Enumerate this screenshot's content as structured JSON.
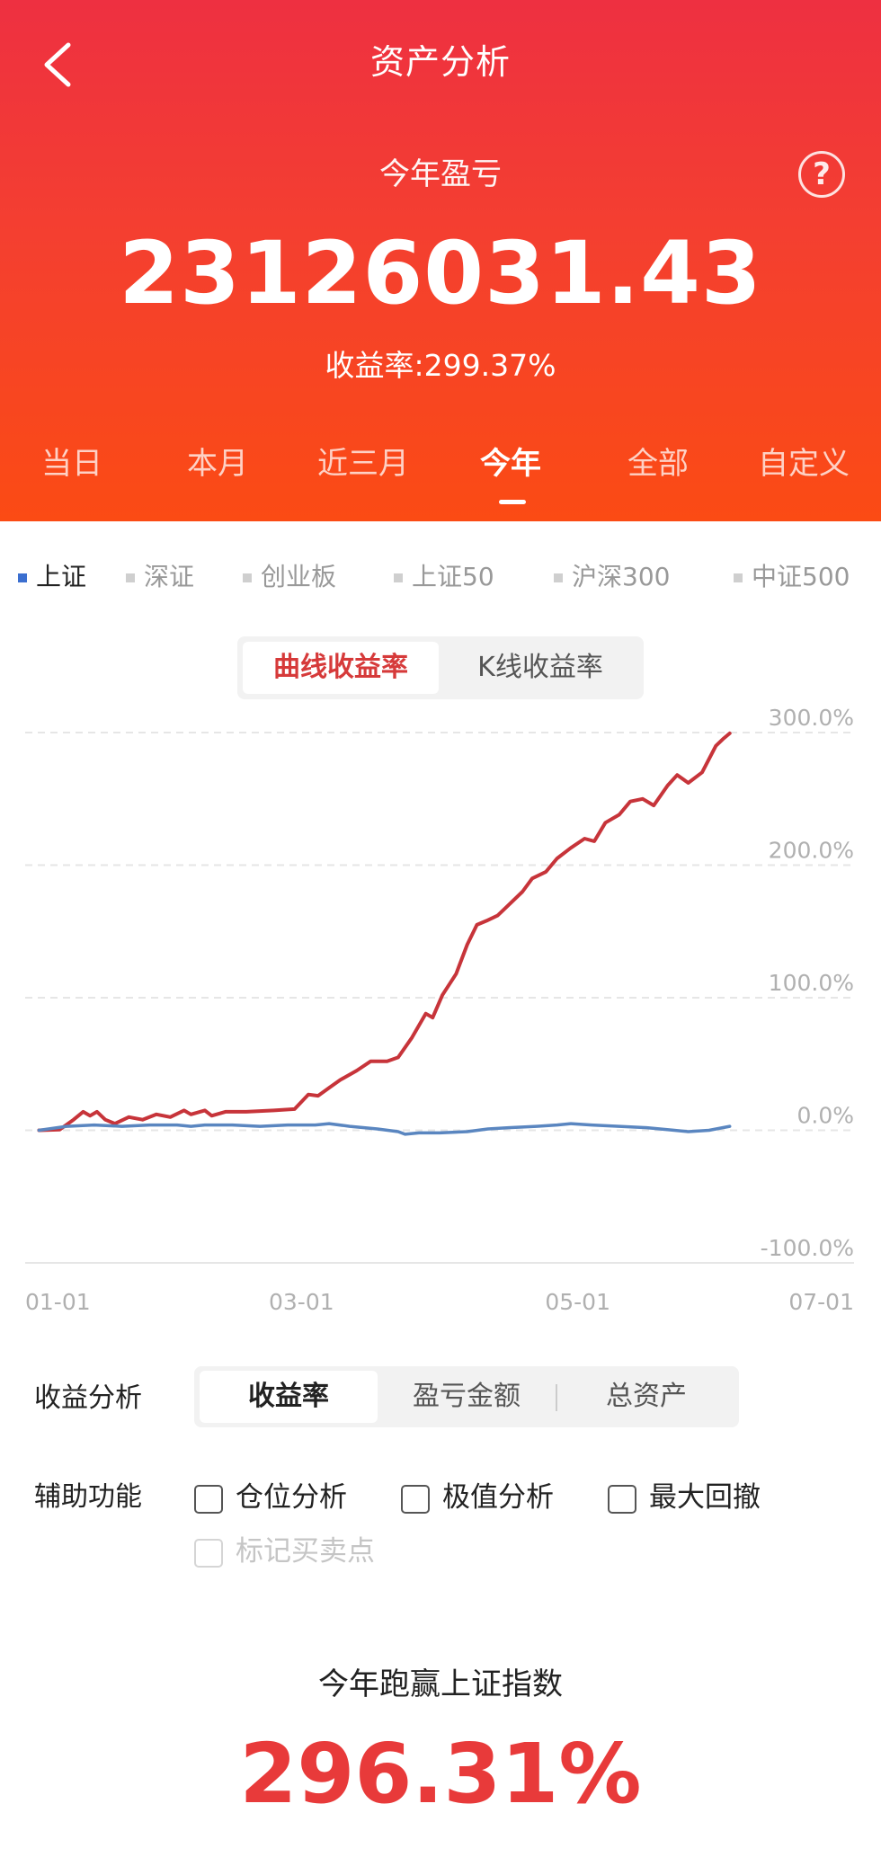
{
  "header": {
    "title": "资产分析",
    "help_icon": "?",
    "pl_label": "今年盈亏",
    "pl_value": "23126031.43",
    "yield_text": "收益率:299.37%"
  },
  "tabs": [
    "当日",
    "本月",
    "近三月",
    "今年",
    "全部",
    "自定义"
  ],
  "active_tab": "今年",
  "indices": [
    "上证",
    "深证",
    "创业板",
    "上证50",
    "沪深300",
    "中证500"
  ],
  "active_index": "上证",
  "chart_mode": {
    "curve": "曲线收益率",
    "kline": "K线收益率"
  },
  "chart_data": {
    "type": "line",
    "y_ticks": [
      "300.0%",
      "200.0%",
      "100.0%",
      "0.0%",
      "-100.0%"
    ],
    "x_ticks": [
      "01-01",
      "03-01",
      "05-01",
      "07-01"
    ],
    "ylim": [
      -100,
      300
    ],
    "x_domain": [
      0,
      6
    ],
    "series": [
      {
        "color": "#c7343a",
        "points": [
          [
            0.1,
            0
          ],
          [
            0.25,
            0.5
          ],
          [
            0.35,
            8
          ],
          [
            0.42,
            14
          ],
          [
            0.47,
            11
          ],
          [
            0.52,
            14
          ],
          [
            0.58,
            8
          ],
          [
            0.65,
            5
          ],
          [
            0.75,
            10
          ],
          [
            0.85,
            8
          ],
          [
            0.95,
            12
          ],
          [
            1.05,
            10
          ],
          [
            1.15,
            15
          ],
          [
            1.2,
            12
          ],
          [
            1.3,
            15
          ],
          [
            1.35,
            11
          ],
          [
            1.45,
            14
          ],
          [
            1.6,
            14
          ],
          [
            1.8,
            15
          ],
          [
            1.95,
            16
          ],
          [
            2.05,
            27
          ],
          [
            2.12,
            26
          ],
          [
            2.2,
            32
          ],
          [
            2.28,
            38
          ],
          [
            2.4,
            45
          ],
          [
            2.5,
            52
          ],
          [
            2.62,
            52
          ],
          [
            2.7,
            55
          ],
          [
            2.8,
            70
          ],
          [
            2.9,
            88
          ],
          [
            2.95,
            85
          ],
          [
            3.02,
            102
          ],
          [
            3.12,
            118
          ],
          [
            3.2,
            140
          ],
          [
            3.27,
            155
          ],
          [
            3.34,
            158
          ],
          [
            3.42,
            162
          ],
          [
            3.5,
            170
          ],
          [
            3.6,
            180
          ],
          [
            3.67,
            190
          ],
          [
            3.77,
            195
          ],
          [
            3.85,
            205
          ],
          [
            3.95,
            213
          ],
          [
            4.05,
            220
          ],
          [
            4.12,
            218
          ],
          [
            4.2,
            232
          ],
          [
            4.3,
            238
          ],
          [
            4.38,
            248
          ],
          [
            4.47,
            250
          ],
          [
            4.55,
            245
          ],
          [
            4.65,
            260
          ],
          [
            4.72,
            268
          ],
          [
            4.8,
            262
          ],
          [
            4.9,
            270
          ],
          [
            5.0,
            290
          ],
          [
            5.05,
            295
          ],
          [
            5.1,
            299.37
          ]
        ]
      },
      {
        "color": "#5a86c0",
        "points": [
          [
            0.1,
            0
          ],
          [
            0.3,
            3
          ],
          [
            0.5,
            4
          ],
          [
            0.7,
            3
          ],
          [
            0.9,
            4
          ],
          [
            1.1,
            4
          ],
          [
            1.2,
            3
          ],
          [
            1.3,
            4
          ],
          [
            1.5,
            4
          ],
          [
            1.7,
            3
          ],
          [
            1.9,
            4
          ],
          [
            2.1,
            4
          ],
          [
            2.2,
            5
          ],
          [
            2.35,
            3
          ],
          [
            2.55,
            1
          ],
          [
            2.7,
            -1
          ],
          [
            2.75,
            -3
          ],
          [
            2.85,
            -2
          ],
          [
            3.0,
            -2
          ],
          [
            3.2,
            -1
          ],
          [
            3.35,
            1
          ],
          [
            3.5,
            2
          ],
          [
            3.7,
            3
          ],
          [
            3.85,
            4
          ],
          [
            3.95,
            5
          ],
          [
            4.1,
            4
          ],
          [
            4.3,
            3
          ],
          [
            4.5,
            2
          ],
          [
            4.7,
            0
          ],
          [
            4.8,
            -1
          ],
          [
            4.95,
            0
          ],
          [
            5.1,
            3
          ]
        ]
      }
    ]
  },
  "analysis": {
    "label": "收益分析",
    "options": [
      "收益率",
      "盈亏金额",
      "总资产"
    ],
    "active": "收益率"
  },
  "aux": {
    "label": "辅助功能",
    "checks": [
      "仓位分析",
      "极值分析",
      "最大回撤"
    ],
    "disabled_check": "标记买卖点"
  },
  "beat": {
    "title": "今年跑赢上证指数",
    "value": "296.31%"
  }
}
